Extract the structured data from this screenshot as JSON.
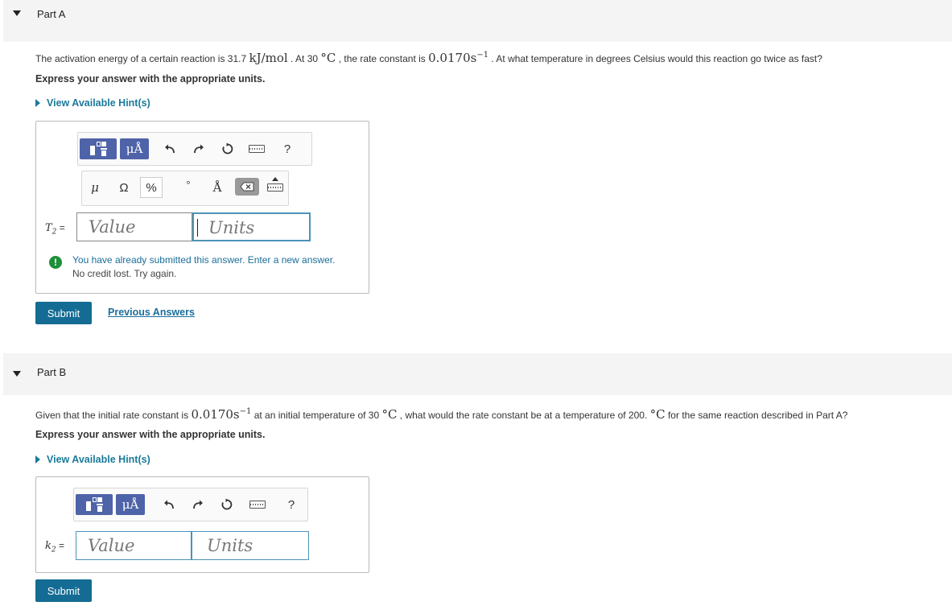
{
  "part_a": {
    "title": "Part A",
    "question": {
      "pre": "The activation energy of a certain reaction is 31.7 ",
      "energy_unit": "kJ/mol",
      "mid1": " . At 30 ",
      "temp_unit": "°C",
      "mid2": " , the rate constant is ",
      "rate_const": "0.0170s",
      "rate_exp": "−1",
      "post": " . At what temperature in degrees Celsius would this reaction go twice as fast?"
    },
    "express": "Express your answer with the appropriate units.",
    "hint": "View Available Hint(s)",
    "toolbar": {
      "units_btn": "μÅ",
      "help": "?",
      "symbols": [
        "μ",
        "Ω",
        "%",
        "°",
        "Å"
      ]
    },
    "var_name": "T",
    "var_sub": "2",
    "eq": " =",
    "value_placeholder": "Value",
    "units_placeholder": "Units",
    "feedback_line1": "You have already submitted this answer. Enter a new answer.",
    "feedback_line2": "No credit lost. Try again.",
    "submit": "Submit",
    "previous_answers": "Previous Answers"
  },
  "part_b": {
    "title": "Part B",
    "question": {
      "pre": "Given that the initial rate constant is ",
      "rate_const": "0.0170s",
      "rate_exp": "−1",
      "mid1": " at an initial temperature of 30  ",
      "temp_unit": "°C",
      "mid2": " , what would the rate constant be at a temperature of 200.  ",
      "temp_unit2": "°C",
      "post": " for the same reaction described in Part A?"
    },
    "express": "Express your answer with the appropriate units.",
    "hint": "View Available Hint(s)",
    "toolbar": {
      "units_btn": "μÅ",
      "help": "?"
    },
    "var_name": "k",
    "var_sub": "2",
    "eq": " =",
    "value_placeholder": "Value",
    "units_placeholder": "Units",
    "submit": "Submit"
  }
}
